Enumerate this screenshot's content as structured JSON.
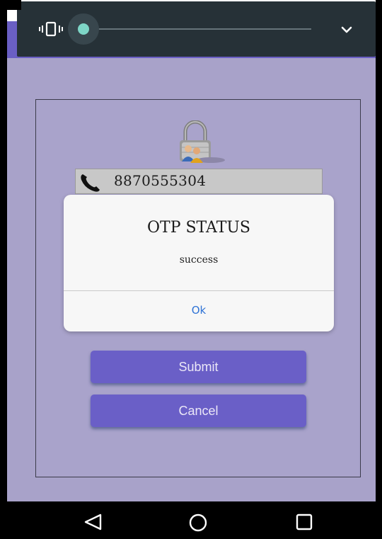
{
  "volume_panel": {
    "mode_icon": "vibrate-icon",
    "level": 0.0,
    "expand_icon": "chevron-down-icon"
  },
  "login_card": {
    "lock_icon": "lock-users-icon",
    "phone": {
      "icon": "phone-icon",
      "value": "8870555304"
    }
  },
  "dialog": {
    "title": "OTP STATUS",
    "message": "success",
    "ok_label": "Ok"
  },
  "buttons": {
    "submit_label": "Submit",
    "cancel_label": "Cancel"
  },
  "nav_bar": {
    "back_icon": "back-triangle-icon",
    "home_icon": "home-circle-icon",
    "recents_icon": "recents-square-icon"
  },
  "colors": {
    "app_bar": "#6a5fc4",
    "background": "#a8a2c9",
    "button": "#6a5fc7",
    "dialog_action": "#2f73d6",
    "volume_panel": "#263137",
    "slider_thumb": "#7ed6c7"
  }
}
